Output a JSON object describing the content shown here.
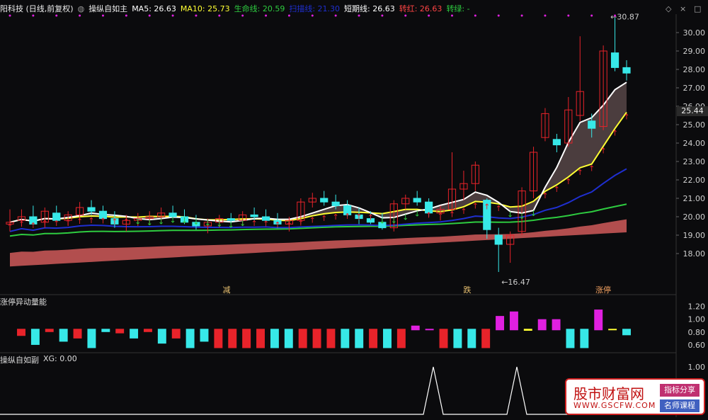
{
  "header": {
    "stock_title": "阳科技 (日线,前复权)",
    "indicator_name": "操纵自如主",
    "ma5": "MA5: 26.63",
    "ma10": "MA10: 25.73",
    "life_line": "生命线: 20.59",
    "hidden_line": "扫描线: 21.30",
    "short_line": "短期线: 26.63",
    "turn_red": "转红: 26.63",
    "turn_green": "转绿: -"
  },
  "colors": {
    "up": "#e8232a",
    "down": "#37e8e8",
    "ma5": "#ffffff",
    "ma10": "#ffff33",
    "life": "#2ecc40",
    "blue": "#1f2fd0",
    "band": "#d05a5a",
    "violet": "#e020e0",
    "yellow": "#ffff33"
  },
  "price_axis": [
    "30.00",
    "29.00",
    "28.00",
    "27.00",
    "26.00",
    "25.00",
    "24.00",
    "23.00",
    "22.00",
    "21.00",
    "20.00",
    "19.00",
    "18.00"
  ],
  "current_price": "25.44",
  "annotations": {
    "high": "30.87",
    "low": "16.47",
    "sig1": "减",
    "sig2": "跌",
    "sig3": "涨停"
  },
  "vol_panel": {
    "title": "涨停异动量能",
    "axis": [
      "1.20",
      "1.00",
      "0.80",
      "0.60"
    ]
  },
  "osc_panel": {
    "title": "操纵自如副",
    "xg": "XG: 0.00",
    "axis": [
      "1.00"
    ]
  },
  "watermark": {
    "line1": "股市财富网",
    "line2": "WWW.GSCFW.COM",
    "badge1": "指标分享",
    "badge2": "名师课程"
  },
  "chart_data": {
    "type": "candlestick",
    "ylim": [
      16.0,
      31.0
    ],
    "candles": [
      [
        19.6,
        20.4,
        19.2,
        19.7
      ],
      [
        19.8,
        20.4,
        19.5,
        20.0
      ],
      [
        20.0,
        20.6,
        19.7,
        19.6
      ],
      [
        19.7,
        20.5,
        19.4,
        20.3
      ],
      [
        20.2,
        20.6,
        19.8,
        19.8
      ],
      [
        19.8,
        20.3,
        19.5,
        20.1
      ],
      [
        20.1,
        20.8,
        19.8,
        20.5
      ],
      [
        20.5,
        20.9,
        20.1,
        20.3
      ],
      [
        20.3,
        20.6,
        19.8,
        19.9
      ],
      [
        19.9,
        20.3,
        19.4,
        19.6
      ],
      [
        19.6,
        20.1,
        19.2,
        19.8
      ],
      [
        19.8,
        20.2,
        19.5,
        19.9
      ],
      [
        19.9,
        20.3,
        19.6,
        20.0
      ],
      [
        20.0,
        20.5,
        19.7,
        20.2
      ],
      [
        20.2,
        20.6,
        19.9,
        20.0
      ],
      [
        20.0,
        20.4,
        19.6,
        19.7
      ],
      [
        19.7,
        20.1,
        19.3,
        19.5
      ],
      [
        19.5,
        19.9,
        19.1,
        19.7
      ],
      [
        19.7,
        20.1,
        19.4,
        19.9
      ],
      [
        19.9,
        20.2,
        19.6,
        19.8
      ],
      [
        19.8,
        20.3,
        19.5,
        20.1
      ],
      [
        20.1,
        20.5,
        19.8,
        20.0
      ],
      [
        20.0,
        20.4,
        19.7,
        19.8
      ],
      [
        19.8,
        20.2,
        19.4,
        19.6
      ],
      [
        19.6,
        20.0,
        19.2,
        19.8
      ],
      [
        19.8,
        21.0,
        19.6,
        20.8
      ],
      [
        20.8,
        21.3,
        20.5,
        21.0
      ],
      [
        21.0,
        21.4,
        20.6,
        20.8
      ],
      [
        20.8,
        21.2,
        20.4,
        20.6
      ],
      [
        20.6,
        20.9,
        20.0,
        20.1
      ],
      [
        20.1,
        20.5,
        19.6,
        19.9
      ],
      [
        19.9,
        20.3,
        19.6,
        19.7
      ],
      [
        19.7,
        20.2,
        19.3,
        19.4
      ],
      [
        19.4,
        20.9,
        19.2,
        20.7
      ],
      [
        20.7,
        21.2,
        20.4,
        21.0
      ],
      [
        21.0,
        21.4,
        20.6,
        20.8
      ],
      [
        20.8,
        21.0,
        20.0,
        20.2
      ],
      [
        20.2,
        20.6,
        19.8,
        20.4
      ],
      [
        20.4,
        23.5,
        20.2,
        21.5
      ],
      [
        21.5,
        22.5,
        20.9,
        21.8
      ],
      [
        21.8,
        23.0,
        21.4,
        22.8
      ],
      [
        20.9,
        21.0,
        18.8,
        19.3
      ],
      [
        19.0,
        19.4,
        17.0,
        18.5
      ],
      [
        18.5,
        19.2,
        17.5,
        19.0
      ],
      [
        19.2,
        21.6,
        19.0,
        21.4
      ],
      [
        21.4,
        23.8,
        21.0,
        23.5
      ],
      [
        24.3,
        25.9,
        24.1,
        25.6
      ],
      [
        24.2,
        24.5,
        23.5,
        23.9
      ],
      [
        24.0,
        26.5,
        23.8,
        25.8
      ],
      [
        25.5,
        29.8,
        25.2,
        26.8
      ],
      [
        25.2,
        25.6,
        24.3,
        24.8
      ],
      [
        24.9,
        29.3,
        24.7,
        29.0
      ],
      [
        28.9,
        30.8,
        27.9,
        28.1
      ],
      [
        28.1,
        28.5,
        27.4,
        27.8
      ]
    ],
    "vol_bars": [
      [
        "r",
        0.74
      ],
      [
        "c",
        0.6
      ],
      [
        "r",
        0.8
      ],
      [
        "c",
        0.65
      ],
      [
        "r",
        0.7
      ],
      [
        "c",
        0.55
      ],
      [
        "c",
        0.8
      ],
      [
        "r",
        0.78
      ],
      [
        "c",
        0.7
      ],
      [
        "r",
        0.8
      ],
      [
        "c",
        0.62
      ],
      [
        "r",
        0.7
      ],
      [
        "c",
        0.55
      ],
      [
        "c",
        0.65
      ],
      [
        "r",
        0.55
      ],
      [
        "r",
        0.55
      ],
      [
        "r",
        0.55
      ],
      [
        "r",
        0.55
      ],
      [
        "c",
        0.55
      ],
      [
        "c",
        0.55
      ],
      [
        "r",
        0.55
      ],
      [
        "r",
        0.55
      ],
      [
        "r",
        0.55
      ],
      [
        "c",
        0.55
      ],
      [
        "c",
        0.55
      ],
      [
        "r",
        0.55
      ],
      [
        "c",
        0.55
      ],
      [
        "r",
        0.55
      ],
      [
        "m",
        0.9
      ],
      [
        "m",
        0.85
      ],
      [
        "r",
        0.55
      ],
      [
        "c",
        0.55
      ],
      [
        "c",
        0.55
      ],
      [
        "r",
        0.55
      ],
      [
        "m",
        1.05
      ],
      [
        "m",
        1.12
      ],
      [
        "y",
        0.82
      ],
      [
        "m",
        1.0
      ],
      [
        "m",
        1.0
      ],
      [
        "c",
        0.55
      ],
      [
        "c",
        0.55
      ],
      [
        "m",
        1.15
      ],
      [
        "y",
        0.85
      ],
      [
        "c",
        0.75
      ]
    ]
  }
}
